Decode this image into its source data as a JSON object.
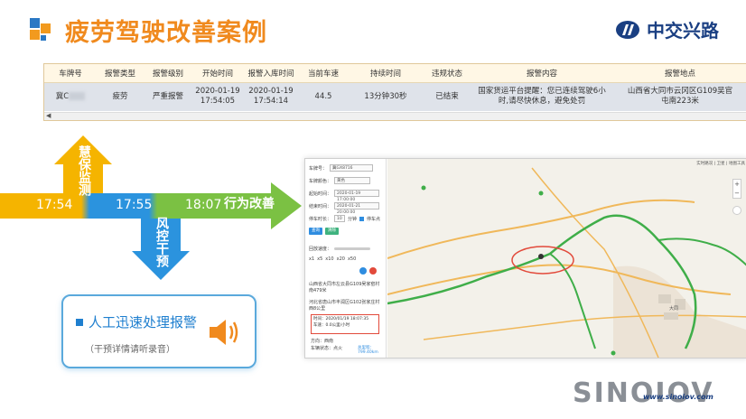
{
  "header": {
    "title": "疲劳驾驶改善案例",
    "brand": "中交兴路"
  },
  "table": {
    "columns": [
      "车牌号",
      "报警类型",
      "报警级别",
      "开始时间",
      "报警入库时间",
      "当前车速",
      "持续时间",
      "违规状态",
      "报警内容",
      "报警地点"
    ],
    "row": {
      "plate": "冀C",
      "type": "疲劳",
      "level": "严重报警",
      "start_date": "2020-01-19",
      "start_time": "17:54:05",
      "store_date": "2020-01-19",
      "store_time": "17:54:14",
      "speed": "44.5",
      "duration": "13分钟30秒",
      "status": "已结束",
      "content_1": "国家货运平台提醒：您已连续驾驶6小",
      "content_2": "时,请尽快休息，避免处罚",
      "location_1": "山西省大同市云冈区G109吴官",
      "location_2": "屯南223米"
    }
  },
  "flow": {
    "t1": "17:54",
    "t2": "17:55",
    "t3": "18:07",
    "up_label": "慧保监测",
    "down_label": "风控干预",
    "right_label": "行为改善"
  },
  "alert": {
    "title": "人工迅速处理报警",
    "subtitle": "（干预详情请听录音）"
  },
  "map": {
    "plate_label": "车牌号：",
    "plate_value": "冀GX8716",
    "color_label": "车牌颜色：",
    "color_value": "黄色",
    "start_label": "起始时间：",
    "start_value": "2020-01-19 17:00:00",
    "end_label": "结束时间：",
    "end_value": "2020-01-21 20:00:00",
    "stop_label": "停车时长：",
    "stop_value": "10",
    "stop_unit": "分钟",
    "stop_point": "停车点",
    "query_btn": "查询",
    "clear_btn": "清除",
    "speed_label": "回放速度：",
    "speed_opts": [
      "x1",
      "x5",
      "x10",
      "x20",
      "x50"
    ],
    "item1": "山西省大同市左云县G109吴家窑村南479米",
    "item2": "河北省唐山市丰润区G102张家庄村西8公里",
    "info_time": "时间：2020/01/19 18:07:35",
    "info_speed": "车速：0.0公里/小时",
    "info_dir": "方向：西南",
    "info_state": "车辆状态：点火",
    "distance": "总里程：799.40km",
    "toolbar": "实时路况 | 卫星 | 地图工具",
    "zoom_in": "+",
    "zoom_out": "−",
    "city": "大同"
  },
  "footer": {
    "logo": "SINOIOV",
    "url": "www.sinoiov.com"
  },
  "colors": {
    "orange": "#f08a1e",
    "yellow": "#f5b400",
    "blue": "#2b93de",
    "green": "#7bc143",
    "navy": "#1a3f82"
  }
}
